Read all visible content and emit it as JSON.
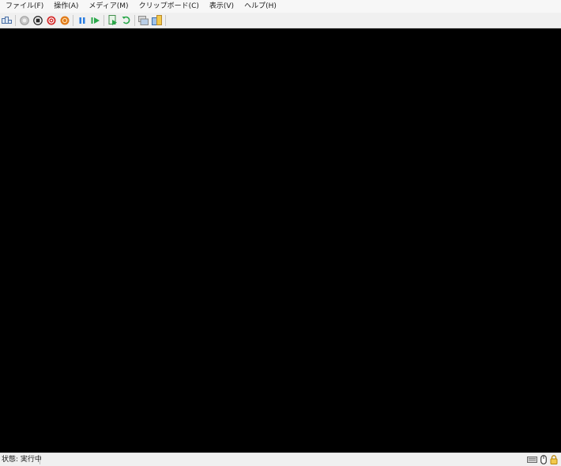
{
  "menu": {
    "file": "ファイル(F)",
    "action": "操作(A)",
    "media": "メディア(M)",
    "clipboard": "クリップボード(C)",
    "view": "表示(V)",
    "help": "ヘルプ(H)"
  },
  "toolbar": {
    "icons": [
      "ctrl-alt-del-icon",
      "start-icon",
      "turn-off-icon",
      "shut-down-icon",
      "save-state-icon",
      "pause-icon",
      "resume-icon",
      "checkpoint-icon",
      "revert-icon",
      "enhanced-session-icon",
      "share-icon"
    ]
  },
  "status": {
    "text": "状態: 実行中",
    "icons": [
      "keyboard-icon",
      "mouse-icon",
      "lock-icon"
    ]
  },
  "colors": {
    "screen": "#000000",
    "turn_off_red": "#d42b2b",
    "save_orange": "#e07a1a",
    "play_green": "#2aa84a",
    "pause_blue": "#2a7de1"
  }
}
